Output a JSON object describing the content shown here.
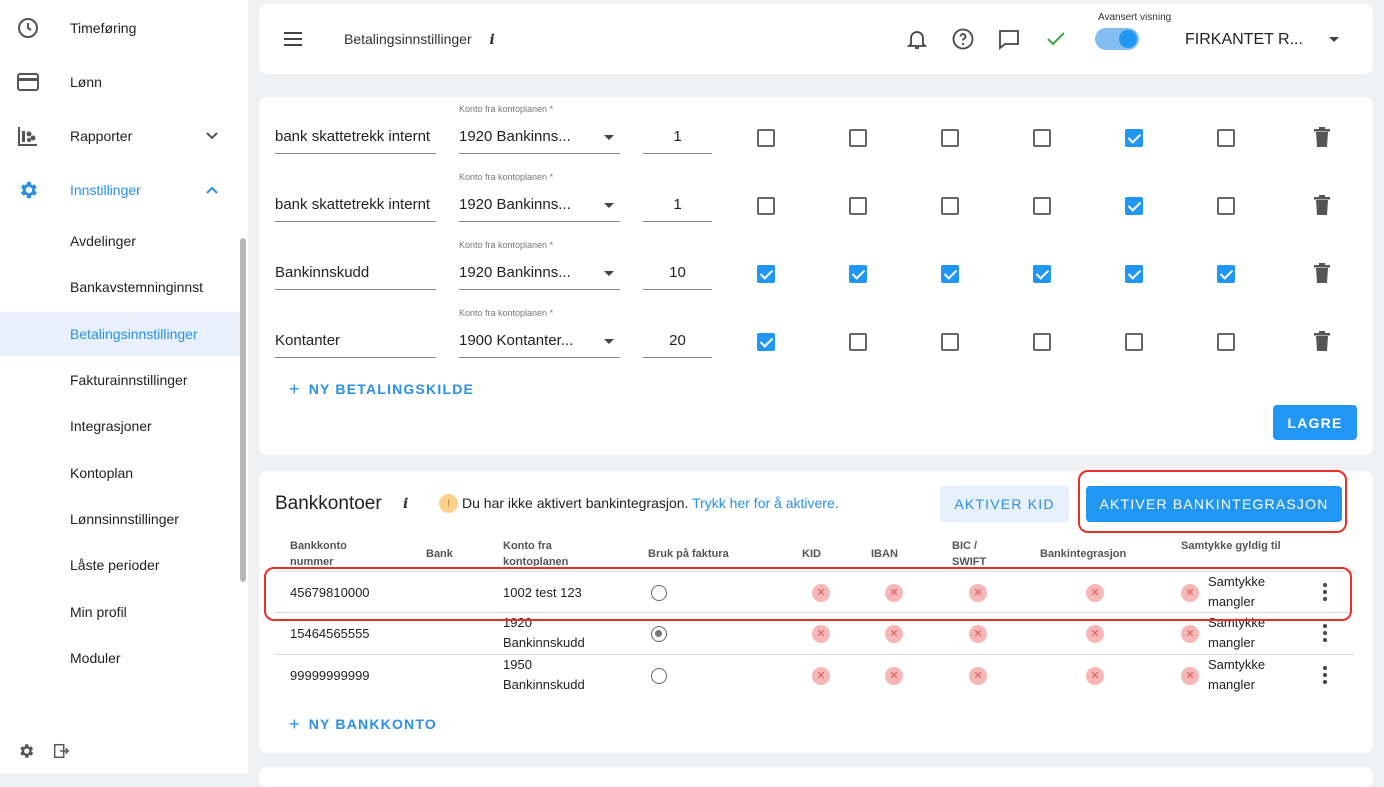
{
  "sidebar": {
    "items": [
      {
        "label": "Timeføring",
        "icon": "clock-icon"
      },
      {
        "label": "Lønn",
        "icon": "credit-card-icon"
      },
      {
        "label": "Rapporter",
        "icon": "reports-icon"
      },
      {
        "label": "Innstillinger",
        "icon": "gear-icon"
      }
    ],
    "subitems": [
      {
        "label": "Avdelinger"
      },
      {
        "label": "Bankavstemninginnst"
      },
      {
        "label": "Betalingsinnstillinger"
      },
      {
        "label": "Fakturainnstillinger"
      },
      {
        "label": "Integrasjoner"
      },
      {
        "label": "Kontoplan"
      },
      {
        "label": "Lønnsinnstillinger"
      },
      {
        "label": "Låste perioder"
      },
      {
        "label": "Min profil"
      },
      {
        "label": "Moduler"
      }
    ],
    "bottom_icons": [
      "settings-icon",
      "logout-icon"
    ]
  },
  "header": {
    "title": "Betalingsinnstillinger",
    "info": "i",
    "advanced_label": "Avansert visning",
    "advanced_on": true,
    "company": "FIRKANTET R...",
    "icons": [
      "bell-icon",
      "help-icon",
      "chat-icon",
      "check-icon"
    ]
  },
  "payment_sources": {
    "field_label": "Konto fra kontoplanen *",
    "rows": [
      {
        "name": "bank skattetrekk internt",
        "account": "1920 Bankinns...",
        "number": "1",
        "checks": [
          false,
          false,
          false,
          false,
          true,
          false
        ]
      },
      {
        "name": "bank skattetrekk internt",
        "account": "1920 Bankinns...",
        "number": "1",
        "checks": [
          false,
          false,
          false,
          false,
          true,
          false
        ]
      },
      {
        "name": "Bankinnskudd",
        "account": "1920 Bankinns...",
        "number": "10",
        "checks": [
          true,
          true,
          true,
          true,
          true,
          true
        ]
      },
      {
        "name": "Kontanter",
        "account": "1900 Kontanter...",
        "number": "20",
        "checks": [
          true,
          false,
          false,
          false,
          false,
          false
        ]
      }
    ],
    "add_label": "NY BETALINGSKILDE",
    "save_label": "LAGRE"
  },
  "bank_accounts": {
    "title": "Bankkontoer",
    "info": "i",
    "warning_icon": "!",
    "warning_text": "Du har ikke aktivert bankintegrasjon.",
    "warning_link": "Trykk her for å aktivere.",
    "activate_kid_label": "AKTIVER KID",
    "activate_integration_label": "AKTIVER BANKINTEGRASJON",
    "headers": {
      "account_no": "Bankkonto nummer",
      "bank": "Bank",
      "account": "Konto fra kontoplanen",
      "use_on_invoice": "Bruk på faktura",
      "kid": "KID",
      "iban": "IBAN",
      "bic": "BIC / SWIFT",
      "integration": "Bankintegrasjon",
      "consent": "Samtykke gyldig til"
    },
    "rows": [
      {
        "account_no": "45679810000",
        "bank": "",
        "account": "1002 test 123",
        "use_on_invoice": false,
        "consent": "Samtykke mangler"
      },
      {
        "account_no": "15464565555",
        "bank": "",
        "account": "1920 Bankinnskudd",
        "use_on_invoice": true,
        "consent": "Samtykke mangler"
      },
      {
        "account_no": "99999999999",
        "bank": "",
        "account": "1950 Bankinnskudd",
        "use_on_invoice": false,
        "consent": "Samtykke mangler"
      }
    ],
    "status_mark": "✕",
    "add_label": "NY BANKKONTO"
  },
  "colors": {
    "accent": "#2196f3",
    "highlight": "#e8302a"
  }
}
